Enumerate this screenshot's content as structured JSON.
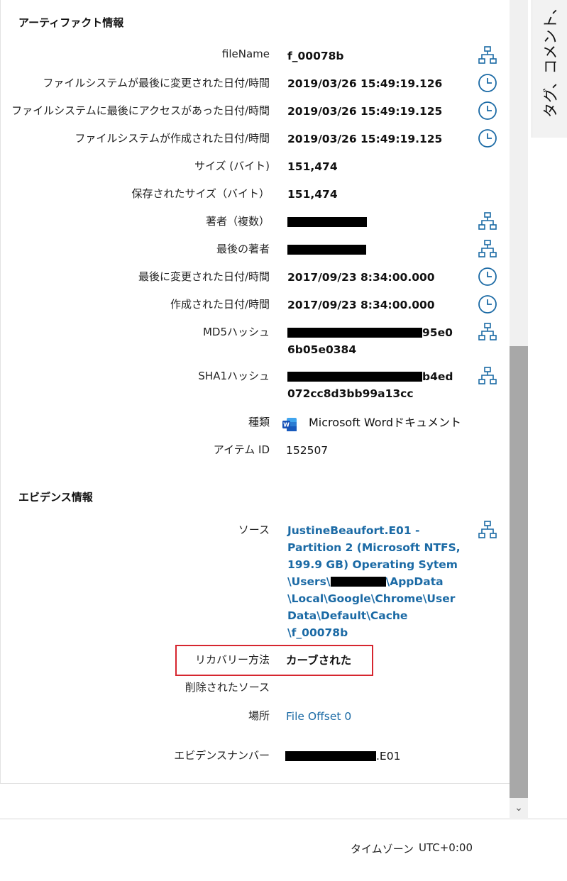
{
  "artifact_section": {
    "title": "アーティファクト情報",
    "rows": [
      {
        "label": "fileName",
        "value": "f_00078b"
      },
      {
        "label": "ファイルシステムが最後に変更された日付/時間",
        "value": "2019/03/26 15:49:19.126"
      },
      {
        "label": "ファイルシステムに最後にアクセスがあった日付/時間",
        "value": "2019/03/26 15:49:19.125"
      },
      {
        "label": "ファイルシステムが作成された日付/時間",
        "value": "2019/03/26 15:49:19.125"
      },
      {
        "label": "サイズ (バイト)",
        "value": "151,474"
      },
      {
        "label": "保存されたサイズ（バイト）",
        "value": "151,474"
      },
      {
        "label": "著者（複数）",
        "value": ""
      },
      {
        "label": "最後の著者",
        "value": ""
      },
      {
        "label": "最後に変更された日付/時間",
        "value": "2017/09/23 8:34:00.000"
      },
      {
        "label": "作成された日付/時間",
        "value": "2017/09/23 8:34:00.000"
      },
      {
        "label": "MD5ハッシュ",
        "value_line1_tail": "95e0",
        "value_line2": "6b05e0384"
      },
      {
        "label": "SHA1ハッシュ",
        "value_line1_tail": "b4ed",
        "value_line2": "072cc8d3bb99a13cc"
      },
      {
        "label": "種類",
        "value": "Microsoft Wordドキュメント"
      },
      {
        "label": "アイテム ID",
        "value": "152507"
      }
    ]
  },
  "evidence_section": {
    "title": "エビデンス情報",
    "source_label": "ソース",
    "source_lines": [
      "JustineBeaufort.E01 -",
      "Partition 2 (Microsoft NTFS,",
      "199.9 GB) Operating Sytem",
      "\\Users\\",
      "\\AppData",
      "\\Local\\Google\\Chrome\\User",
      "Data\\Default\\Cache",
      "\\f_00078b"
    ],
    "recovery_label": "リカバリー方法",
    "recovery_value": "カーブされた",
    "deleted_source_label": "削除されたソース",
    "location_label": "場所",
    "location_value": "File Offset 0",
    "evidence_number_label": "エビデンスナンバー",
    "evidence_number_suffix": ".E01"
  },
  "side_tab": {
    "label": "タグ、コメント、プロ"
  },
  "status_bar": {
    "timezone_label": "タイムゾーン",
    "timezone_value": "UTC+0:00"
  },
  "colors": {
    "link": "#1b6aa5",
    "icon": "#1b6aa5",
    "highlight": "#d6262f"
  },
  "icons": {
    "hierarchy": "hierarchy-icon",
    "clock": "clock-icon",
    "word": "word-file-icon"
  }
}
